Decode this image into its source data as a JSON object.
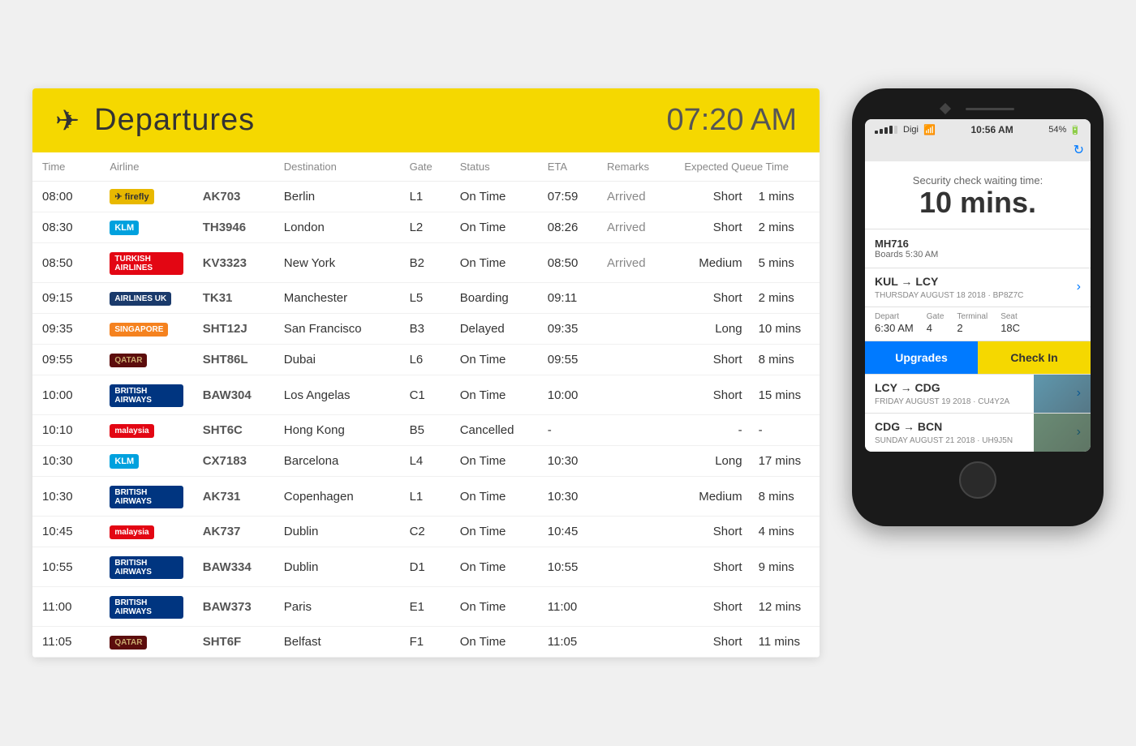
{
  "board": {
    "title": "Departures",
    "time": "07:20 AM",
    "columns": {
      "time": "Time",
      "airline": "Airline",
      "destination": "Destination",
      "gate": "Gate",
      "status": "Status",
      "eta": "ETA",
      "remarks": "Remarks",
      "expected_queue_time": "Expected Queue Time"
    },
    "flights": [
      {
        "time": "08:00",
        "airline": "Firefly",
        "airline_code": "firefly",
        "flight": "AK703",
        "destination": "Berlin",
        "gate": "L1",
        "status": "On Time",
        "status_class": "status-ontime",
        "eta": "07:59",
        "remarks": "Arrived",
        "queue_label": "Short",
        "queue_label_class": "queue-short",
        "queue_mins": "1 mins",
        "queue_mins_class": "queue-mins"
      },
      {
        "time": "08:30",
        "airline": "KLM",
        "airline_code": "klm",
        "flight": "TH3946",
        "destination": "London",
        "gate": "L2",
        "status": "On Time",
        "status_class": "status-ontime",
        "eta": "08:26",
        "remarks": "Arrived",
        "queue_label": "Short",
        "queue_label_class": "queue-short",
        "queue_mins": "2 mins",
        "queue_mins_class": "queue-mins"
      },
      {
        "time": "08:50",
        "airline": "Turkish Airlines",
        "airline_code": "turkish",
        "flight": "KV3323",
        "destination": "New York",
        "gate": "B2",
        "status": "On Time",
        "status_class": "status-ontime",
        "eta": "08:50",
        "remarks": "Arrived",
        "queue_label": "Medium",
        "queue_label_class": "queue-medium",
        "queue_mins": "5 mins",
        "queue_mins_class": "queue-mins"
      },
      {
        "time": "09:15",
        "airline": "Airlines UK",
        "airline_code": "airlineuk",
        "flight": "TK31",
        "destination": "Manchester",
        "gate": "L5",
        "status": "Boarding",
        "status_class": "status-boarding",
        "eta": "09:11",
        "remarks": "",
        "queue_label": "Short",
        "queue_label_class": "queue-short",
        "queue_mins": "2 mins",
        "queue_mins_class": "queue-mins"
      },
      {
        "time": "09:35",
        "airline": "Singapore Airlines",
        "airline_code": "singapore",
        "flight": "SHT12J",
        "destination": "San Francisco",
        "gate": "B3",
        "status": "Delayed",
        "status_class": "status-delayed",
        "eta": "09:35",
        "remarks": "",
        "queue_label": "Long",
        "queue_label_class": "queue-long",
        "queue_mins": "10 mins",
        "queue_mins_class": "queue-mins-long"
      },
      {
        "time": "09:55",
        "airline": "Qatar Airways",
        "airline_code": "qatar",
        "flight": "SHT86L",
        "destination": "Dubai",
        "gate": "L6",
        "status": "On Time",
        "status_class": "status-ontime",
        "eta": "09:55",
        "remarks": "",
        "queue_label": "Short",
        "queue_label_class": "queue-short",
        "queue_mins": "8 mins",
        "queue_mins_class": "queue-mins"
      },
      {
        "time": "10:00",
        "airline": "British Airways",
        "airline_code": "british",
        "flight": "BAW304",
        "destination": "Los Angelas",
        "gate": "C1",
        "status": "On Time",
        "status_class": "status-ontime",
        "eta": "10:00",
        "remarks": "",
        "queue_label": "Short",
        "queue_label_class": "queue-short",
        "queue_mins": "15 mins",
        "queue_mins_class": "queue-mins"
      },
      {
        "time": "10:10",
        "airline": "Malaysia Airlines",
        "airline_code": "malaysia",
        "flight": "SHT6C",
        "destination": "Hong Kong",
        "gate": "B5",
        "status": "Cancelled",
        "status_class": "status-cancelled",
        "eta": "-",
        "remarks": "",
        "queue_label": "-",
        "queue_label_class": "",
        "queue_mins": "-",
        "queue_mins_class": "queue-mins"
      },
      {
        "time": "10:30",
        "airline": "KLM",
        "airline_code": "klm",
        "flight": "CX7183",
        "destination": "Barcelona",
        "gate": "L4",
        "status": "On Time",
        "status_class": "status-ontime",
        "eta": "10:30",
        "remarks": "",
        "queue_label": "Long",
        "queue_label_class": "queue-long",
        "queue_mins": "17 mins",
        "queue_mins_class": "queue-mins-long"
      },
      {
        "time": "10:30",
        "airline": "British Airways",
        "airline_code": "british",
        "flight": "AK731",
        "destination": "Copenhagen",
        "gate": "L1",
        "status": "On Time",
        "status_class": "status-ontime",
        "eta": "10:30",
        "remarks": "",
        "queue_label": "Medium",
        "queue_label_class": "queue-medium",
        "queue_mins": "8 mins",
        "queue_mins_class": "queue-mins"
      },
      {
        "time": "10:45",
        "airline": "Malaysia Airlines",
        "airline_code": "malaysia",
        "flight": "AK737",
        "destination": "Dublin",
        "gate": "C2",
        "status": "On Time",
        "status_class": "status-ontime",
        "eta": "10:45",
        "remarks": "",
        "queue_label": "Short",
        "queue_label_class": "queue-short",
        "queue_mins": "4 mins",
        "queue_mins_class": "queue-mins"
      },
      {
        "time": "10:55",
        "airline": "British Airways",
        "airline_code": "british",
        "flight": "BAW334",
        "destination": "Dublin",
        "gate": "D1",
        "status": "On Time",
        "status_class": "status-ontime",
        "eta": "10:55",
        "remarks": "",
        "queue_label": "Short",
        "queue_label_class": "queue-short",
        "queue_mins": "9 mins",
        "queue_mins_class": "queue-mins"
      },
      {
        "time": "11:00",
        "airline": "British Airways",
        "airline_code": "british",
        "flight": "BAW373",
        "destination": "Paris",
        "gate": "E1",
        "status": "On Time",
        "status_class": "status-ontime",
        "eta": "11:00",
        "remarks": "",
        "queue_label": "Short",
        "queue_label_class": "queue-short",
        "queue_mins": "12 mins",
        "queue_mins_class": "queue-mins"
      },
      {
        "time": "11:05",
        "airline": "Qatar Airways",
        "airline_code": "qatar",
        "flight": "SHT6F",
        "destination": "Belfast",
        "gate": "F1",
        "status": "On Time",
        "status_class": "status-ontime",
        "eta": "11:05",
        "remarks": "",
        "queue_label": "Short",
        "queue_label_class": "queue-short",
        "queue_mins": "11 mins",
        "queue_mins_class": "queue-mins"
      }
    ]
  },
  "phone": {
    "status_bar": {
      "signal": "●●●●◦",
      "carrier": "Digi",
      "wifi": "wifi",
      "time": "10:56 AM",
      "battery": "54%"
    },
    "security_wait": {
      "label": "Security check waiting time:",
      "time": "10 mins."
    },
    "current_flight": {
      "number": "MH716",
      "boards": "Boards 5:30 AM"
    },
    "route1": {
      "from": "KUL",
      "arrow": "→",
      "to": "LCY",
      "date": "THURSDAY AUGUST 18 2018 · BP8Z7C"
    },
    "details": {
      "depart_label": "Depart",
      "depart_value": "6:30 AM",
      "gate_label": "Gate",
      "gate_value": "4",
      "terminal_label": "Terminal",
      "terminal_value": "2",
      "seat_label": "Seat",
      "seat_value": "18C"
    },
    "buttons": {
      "upgrades": "Upgrades",
      "checkin": "Check In"
    },
    "route2": {
      "from": "LCY",
      "arrow": "→",
      "to": "CDG",
      "date": "FRIDAY AUGUST 19 2018 · CU4Y2A"
    },
    "route3": {
      "from": "CDG",
      "arrow": "→",
      "to": "BCN",
      "date": "SUNDAY AUGUST 21 2018 · UH9J5N"
    }
  }
}
